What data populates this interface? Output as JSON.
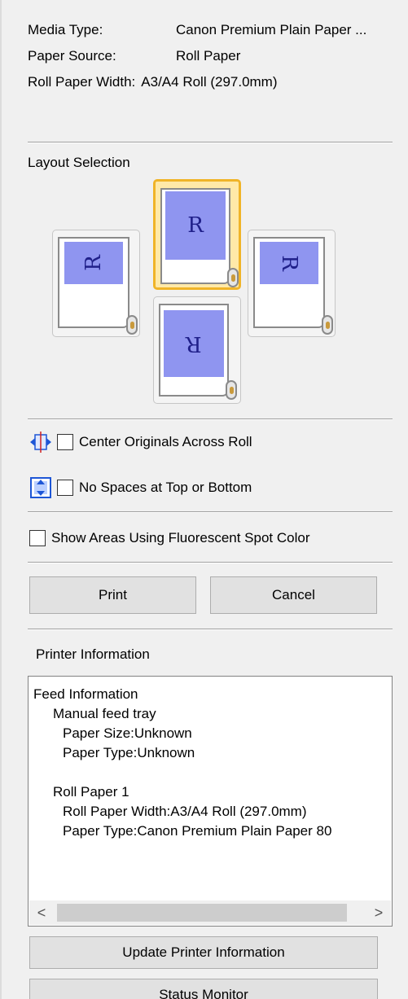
{
  "media_info": {
    "media_type_label": "Media Type:",
    "media_type_value": "Canon Premium Plain Paper ...",
    "paper_source_label": "Paper Source:",
    "paper_source_value": "Roll Paper",
    "roll_width_label": "Roll Paper Width:",
    "roll_width_value": "A3/A4 Roll (297.0mm)"
  },
  "layout": {
    "title": "Layout Selection",
    "glyph": "R",
    "options": [
      {
        "name": "rotated-left",
        "selected": false
      },
      {
        "name": "normal",
        "selected": true
      },
      {
        "name": "rotated-right",
        "selected": false
      },
      {
        "name": "rotated-180",
        "selected": false
      }
    ]
  },
  "options": {
    "center_originals": "Center Originals Across Roll",
    "no_spaces": "No Spaces at Top or Bottom",
    "fluorescent": "Show Areas Using Fluorescent Spot Color"
  },
  "buttons": {
    "print": "Print",
    "cancel": "Cancel",
    "update": "Update Printer Information",
    "status": "Status Monitor"
  },
  "printer_info": {
    "title": "Printer Information",
    "lines": [
      "Feed Information",
      "Manual feed tray",
      "Paper Size:Unknown",
      "Paper Type:Unknown",
      "",
      "Roll Paper 1",
      "Roll Paper Width:A3/A4 Roll (297.0mm)",
      "Paper Type:Canon Premium Plain Paper 80"
    ],
    "scroll_left": "<",
    "scroll_right": ">"
  },
  "colors": {
    "selected_border": "#f0b428",
    "selected_fill": "#ffe9a8",
    "print_area": "#8f95f0"
  }
}
